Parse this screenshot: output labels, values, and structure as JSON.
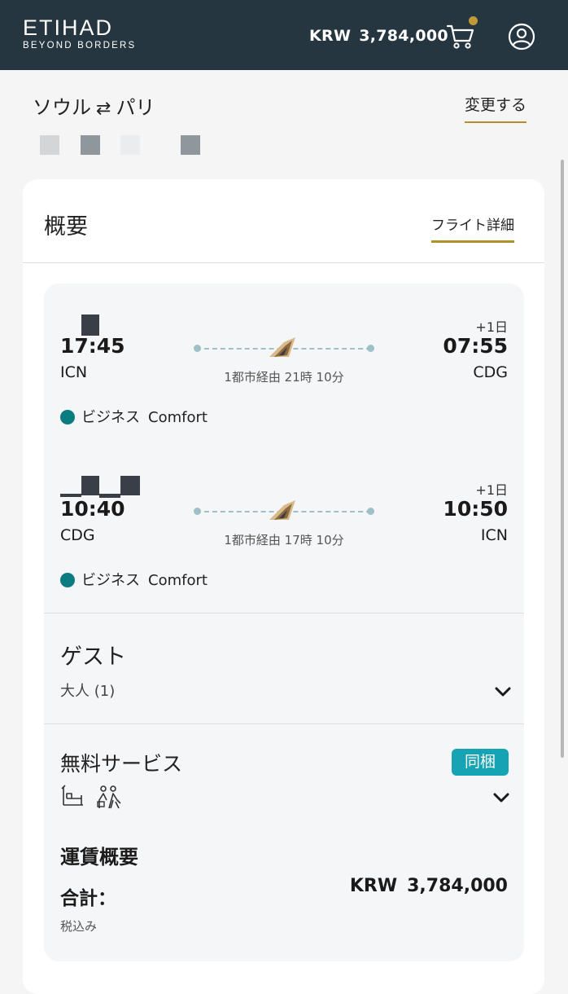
{
  "header": {
    "logo_main": "ETIHAD",
    "logo_sub": "BEYOND BORDERS",
    "currency": "KRW",
    "amount": "3,784,000",
    "cart_icon": "cart-icon",
    "user_icon": "user-circle-icon",
    "cart_dot_color": "#c19a37"
  },
  "route": {
    "origin": "ソウル",
    "arrow": "⇄",
    "destination": "パリ",
    "change_label": "変更する"
  },
  "summary": {
    "title": "概要",
    "flight_detail_label": "フライト詳細"
  },
  "flights": [
    {
      "dep_time": "17:45",
      "dep_code": "ICN",
      "arr_time": "07:55",
      "arr_code": "CDG",
      "plus_day": "+1日",
      "duration": "1都市経由 21時 10分",
      "cabin_class": "ビジネス",
      "fare_family": "Comfort"
    },
    {
      "dep_time": "10:40",
      "dep_code": "CDG",
      "arr_time": "10:50",
      "arr_code": "ICN",
      "plus_day": "+1日",
      "duration": "1都市経由 17時 10分",
      "cabin_class": "ビジネス",
      "fare_family": "Comfort"
    }
  ],
  "guests": {
    "title": "ゲスト",
    "value": "大人 (1)"
  },
  "services": {
    "title": "無料サービス",
    "badge": "同梱",
    "icons": [
      "lounge-seat-icon",
      "chauffeur-icon"
    ]
  },
  "fare": {
    "title": "運賃概要",
    "total_label": "合計：",
    "currency": "KRW",
    "amount": "3,784,000",
    "tax_note": "税込み"
  },
  "colors": {
    "header_bg": "#253641",
    "accent_gold": "#b38f2c",
    "cabin_dot": "#0b7b82",
    "badge_bg": "#16a3b3"
  }
}
